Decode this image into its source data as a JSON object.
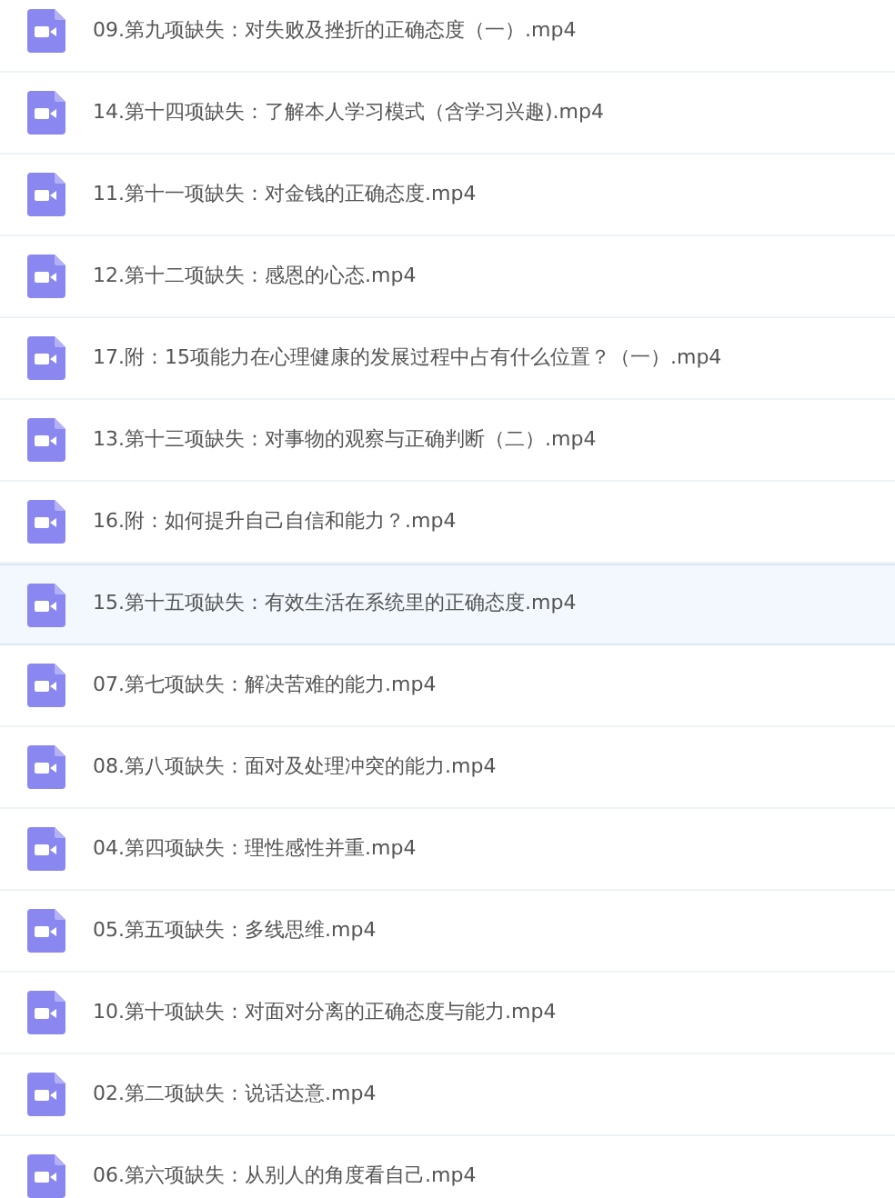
{
  "files": [
    {
      "name": "09.第九项缺失：对失败及挫折的正确态度（一）.mp4",
      "selected": false
    },
    {
      "name": "14.第十四项缺失：了解本人学习模式（含学习兴趣).mp4",
      "selected": false
    },
    {
      "name": "11.第十一项缺失：对金钱的正确态度.mp4",
      "selected": false
    },
    {
      "name": "12.第十二项缺失：感恩的心态.mp4",
      "selected": false
    },
    {
      "name": "17.附：15项能力在心理健康的发展过程中占有什么位置？（一）.mp4",
      "selected": false
    },
    {
      "name": "13.第十三项缺失：对事物的观察与正确判断（二）.mp4",
      "selected": false
    },
    {
      "name": "16.附：如何提升自己自信和能力？.mp4",
      "selected": false
    },
    {
      "name": "15.第十五项缺失：有效生活在系统里的正确态度.mp4",
      "selected": true
    },
    {
      "name": "07.第七项缺失：解决苦难的能力.mp4",
      "selected": false
    },
    {
      "name": "08.第八项缺失：面对及处理冲突的能力.mp4",
      "selected": false
    },
    {
      "name": "04.第四项缺失：理性感性并重.mp4",
      "selected": false
    },
    {
      "name": "05.第五项缺失：多线思维.mp4",
      "selected": false
    },
    {
      "name": "10.第十项缺失：对面对分离的正确态度与能力.mp4",
      "selected": false
    },
    {
      "name": "02.第二项缺失：说话达意.mp4",
      "selected": false
    },
    {
      "name": "06.第六项缺失：从别人的角度看自己.mp4",
      "selected": false
    }
  ]
}
